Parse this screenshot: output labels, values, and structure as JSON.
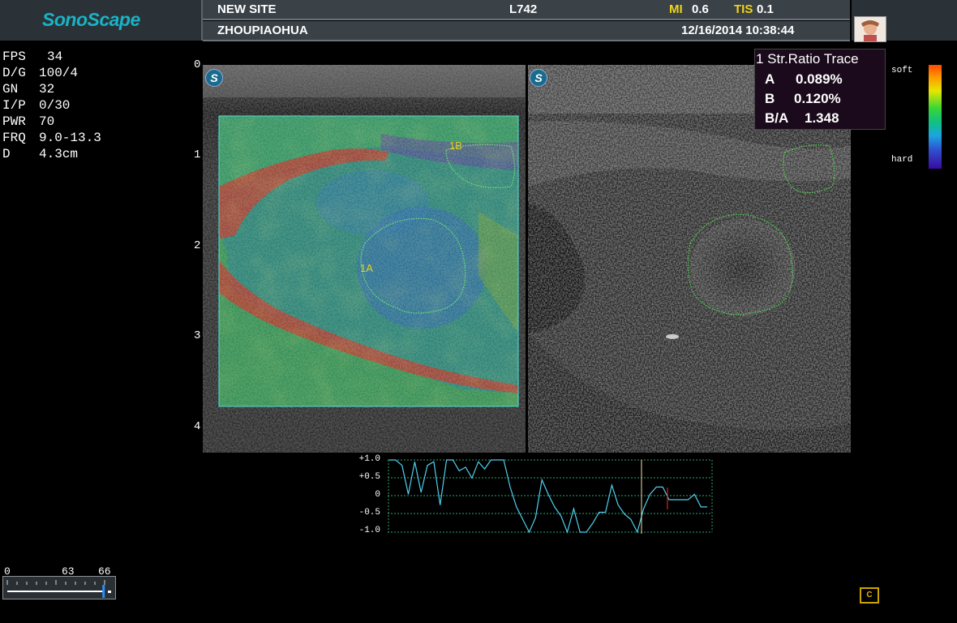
{
  "header": {
    "brand": "SonoScape",
    "site": "NEW SITE",
    "probe": "L742",
    "mi_label": "MI",
    "mi_value": "0.6",
    "tis_label": "TIS",
    "tis_value": "0.1",
    "patient": "ZHOUPIAOHUA",
    "datetime": "12/16/2014 10:38:44"
  },
  "params": [
    {
      "label": "FPS",
      "value": "34"
    },
    {
      "label": "D/G",
      "value": "100/4"
    },
    {
      "label": "GN",
      "value": "32"
    },
    {
      "label": "I/P",
      "value": "0/30"
    },
    {
      "label": "PWR",
      "value": "70"
    },
    {
      "label": "FRQ",
      "value": "9.0-13.3"
    },
    {
      "label": "D",
      "value": "4.3cm"
    }
  ],
  "depth_scale": [
    "0",
    "1",
    "2",
    "3",
    "4"
  ],
  "image": {
    "left_badge": "S",
    "right_badge": "S",
    "roi_a_label": "1A",
    "roi_b_label": "1B"
  },
  "strain_ratio": {
    "title": "1 Str.Ratio Trace",
    "a_label": "A",
    "a_value": "0.089%",
    "b_label": "B",
    "b_value": "0.120%",
    "ba_label": "B/A",
    "ba_value": "1.348"
  },
  "color_bar": {
    "top_label": "soft",
    "bottom_label": "hard"
  },
  "trace": {
    "y_labels": [
      "+1.0",
      "+0.5",
      "0",
      "-0.5",
      "-1.0"
    ],
    "values": [
      1.0,
      1.0,
      0.85,
      0.05,
      0.95,
      0.1,
      0.85,
      0.95,
      -0.25,
      1.0,
      1.0,
      0.7,
      0.8,
      0.5,
      0.95,
      0.75,
      1.0,
      1.0,
      1.0,
      0.25,
      -0.3,
      -0.65,
      -1.0,
      -0.6,
      0.45,
      0.05,
      -0.3,
      -0.55,
      -1.0,
      -0.35,
      -1.0,
      -1.0,
      -0.75,
      -0.45,
      -0.45,
      0.3,
      -0.25,
      -0.5,
      -0.65,
      -1.0,
      -0.35,
      0.05,
      0.25,
      0.25,
      -0.1,
      -0.1,
      -0.1,
      -0.1,
      0.05,
      -0.3,
      -0.3
    ]
  },
  "slider": {
    "min": "0",
    "mid": "63",
    "max": "66",
    "level": 0.93
  },
  "status_icon": "film-cine-icon"
}
